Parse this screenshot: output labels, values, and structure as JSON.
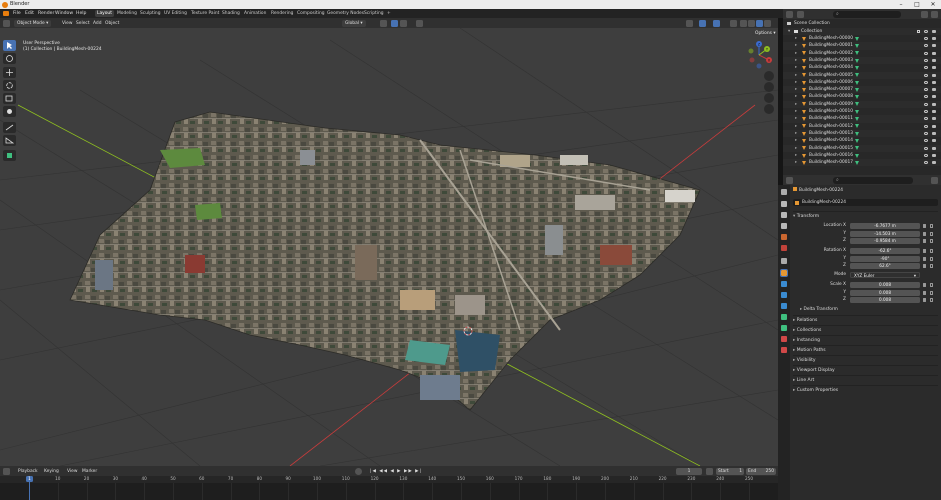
{
  "app": {
    "title": "Blender"
  },
  "menus": [
    "File",
    "Edit",
    "Render",
    "Window",
    "Help"
  ],
  "workspaces": [
    "Layout",
    "Modeling",
    "Sculpting",
    "UV Editing",
    "Texture Paint",
    "Shading",
    "Animation",
    "Rendering",
    "Compositing",
    "Geometry Nodes",
    "Scripting"
  ],
  "workspace_add": "+",
  "topright": {
    "scene": "Scene",
    "viewlayer": "ViewLayer"
  },
  "viewport_header": {
    "mode": "Object Mode",
    "menus": [
      "View",
      "Select",
      "Add",
      "Object"
    ],
    "transform_orientation": "Global",
    "options": "Options"
  },
  "viewport": {
    "overlay_line1": "User Perspective",
    "overlay_line2": "(1) Collection | BuildingMesh-00224",
    "gizmo": {
      "x": "X",
      "y": "Y",
      "z": "Z"
    }
  },
  "timeline": {
    "menus": [
      "Playback",
      "Keying",
      "View",
      "Marker"
    ],
    "current_frame": "1",
    "start_label": "Start",
    "start": "1",
    "end_label": "End",
    "end": "250",
    "ticks": [
      "0",
      "10",
      "20",
      "30",
      "40",
      "50",
      "60",
      "70",
      "80",
      "90",
      "100",
      "110",
      "120",
      "130",
      "140",
      "150",
      "160",
      "170",
      "180",
      "190",
      "200",
      "210",
      "220",
      "230",
      "240",
      "250"
    ]
  },
  "outliner": {
    "scene_collection": "Scene Collection",
    "collection": "Collection",
    "items": [
      "BuildingMesh-00000",
      "BuildingMesh-00001",
      "BuildingMesh-00002",
      "BuildingMesh-00003",
      "BuildingMesh-00004",
      "BuildingMesh-00005",
      "BuildingMesh-00006",
      "BuildingMesh-00007",
      "BuildingMesh-00008",
      "BuildingMesh-00009",
      "BuildingMesh-00010",
      "BuildingMesh-00011",
      "BuildingMesh-00012",
      "BuildingMesh-00013",
      "BuildingMesh-00014",
      "BuildingMesh-00015",
      "BuildingMesh-00016",
      "BuildingMesh-00017"
    ]
  },
  "properties": {
    "object_name_header": "BuildingMesh-00224",
    "object_name_field": "BuildingMesh-00224",
    "transform_label": "Transform",
    "location_label": "Location X",
    "y_label": "Y",
    "z_label": "Z",
    "location": [
      "-6.7677 m",
      "-14.503 m",
      "-0.9584 m"
    ],
    "rotation_label": "Rotation X",
    "rotation": [
      "-62.6°",
      "-90°",
      "62.6°"
    ],
    "mode_label": "Mode",
    "mode_value": "XYZ Euler",
    "scale_label": "Scale X",
    "scale": [
      "0.008",
      "0.008",
      "0.008"
    ],
    "delta_transform": "Delta Transform",
    "sections": [
      "Relations",
      "Collections",
      "Instancing",
      "Motion Paths",
      "Visibility",
      "Viewport Display",
      "Line Art",
      "Custom Properties"
    ]
  },
  "colors": {
    "accent": "#4772b3",
    "object_orange": "#e59733",
    "mesh_green": "#3fbf7f",
    "axis_x": "#c83c3c",
    "axis_y": "#8fbf20"
  }
}
